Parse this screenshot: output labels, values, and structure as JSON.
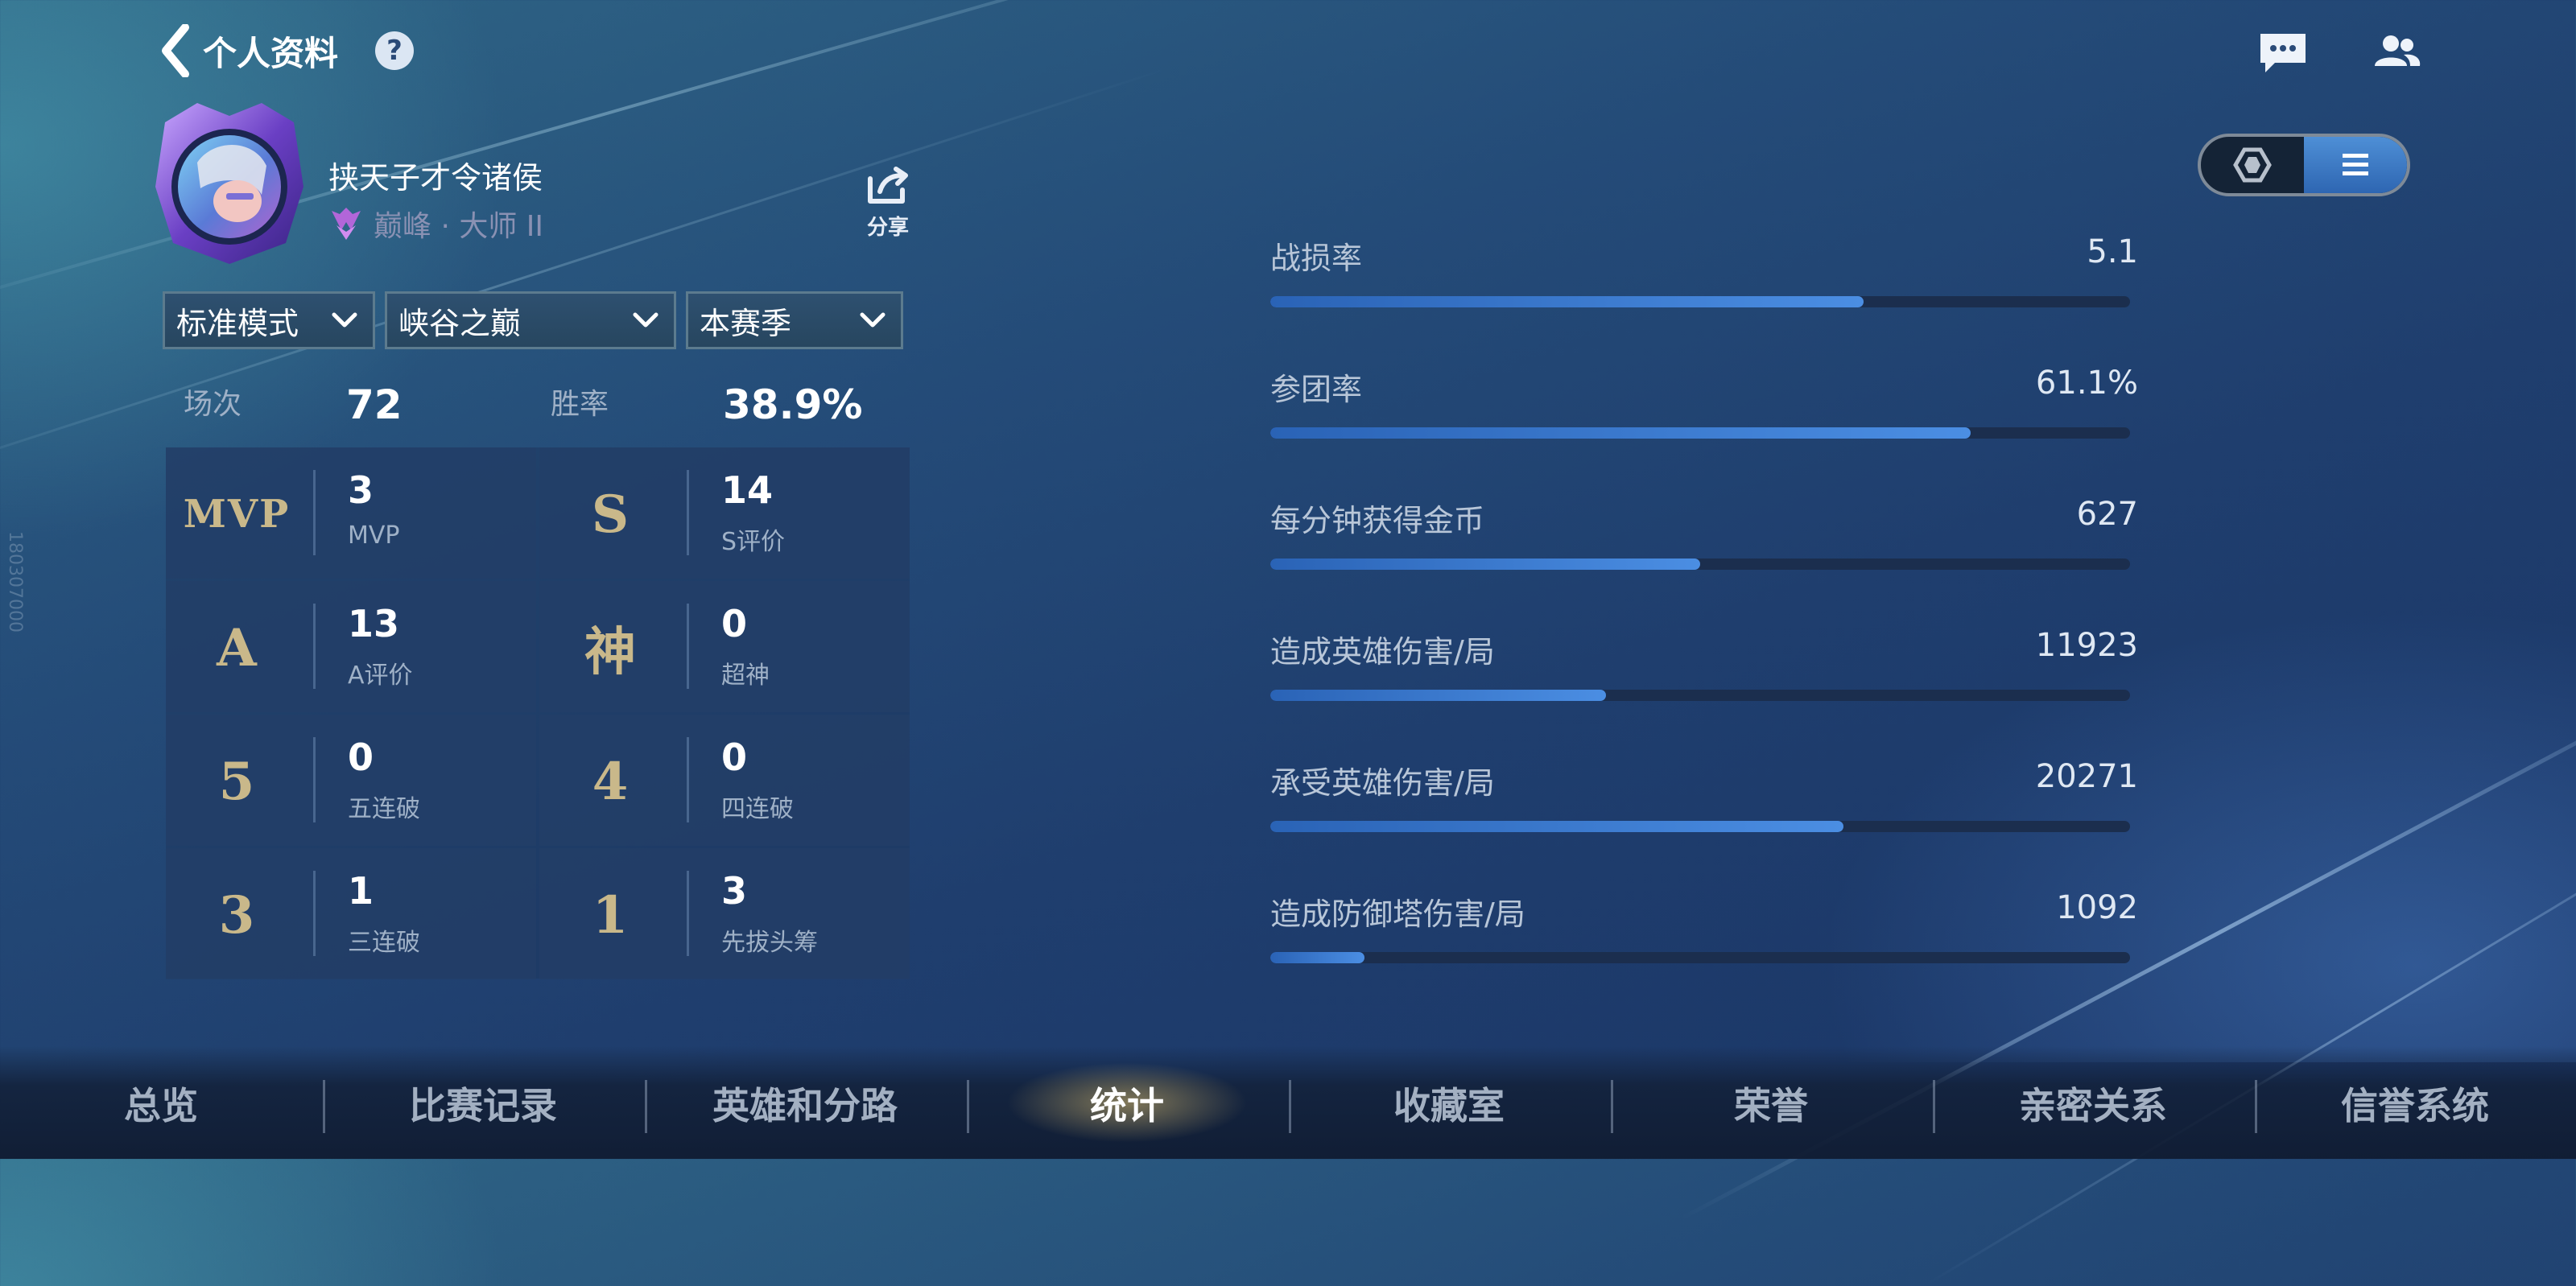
{
  "header": {
    "title": "个人资料",
    "help_glyph": "?"
  },
  "profile": {
    "name": "挟天子才令诸侯",
    "rank": "巅峰 · 大师 II",
    "share_label": "分享"
  },
  "filters": {
    "mode": "标准模式",
    "map": "峡谷之巅",
    "season": "本赛季"
  },
  "summary": {
    "matches_label": "场次",
    "matches_value": "72",
    "winrate_label": "胜率",
    "winrate_value": "38.9%"
  },
  "achievements": [
    {
      "badge": "MVP",
      "value": "3",
      "label": "MVP"
    },
    {
      "badge": "S",
      "value": "14",
      "label": "S评价"
    },
    {
      "badge": "A",
      "value": "13",
      "label": "A评价"
    },
    {
      "badge": "神",
      "value": "0",
      "label": "超神"
    },
    {
      "badge": "5",
      "value": "0",
      "label": "五连破"
    },
    {
      "badge": "4",
      "value": "0",
      "label": "四连破"
    },
    {
      "badge": "3",
      "value": "1",
      "label": "三连破"
    },
    {
      "badge": "1",
      "value": "3",
      "label": "先拔头筹"
    }
  ],
  "stats": [
    {
      "label": "战损率",
      "value": "5.1",
      "fill_ratio": 0.69
    },
    {
      "label": "参团率",
      "value": "61.1%",
      "fill_ratio": 0.815
    },
    {
      "label": "每分钟获得金币",
      "value": "627",
      "fill_ratio": 0.5
    },
    {
      "label": "造成英雄伤害/局",
      "value": "11923",
      "fill_ratio": 0.39
    },
    {
      "label": "承受英雄伤害/局",
      "value": "20271",
      "fill_ratio": 0.667
    },
    {
      "label": "造成防御塔伤害/局",
      "value": "1092",
      "fill_ratio": 0.11
    }
  ],
  "bottom_nav": {
    "tabs": [
      "总览",
      "比赛记录",
      "英雄和分路",
      "统计",
      "收藏室",
      "荣誉",
      "亲密关系",
      "信誉系统"
    ],
    "active_index": 3
  },
  "side_id": "180307000",
  "colors": {
    "accent_blue": "#4b8ee3",
    "badge_gold": "#c9b88a",
    "rank_purple": "#b266d9"
  }
}
